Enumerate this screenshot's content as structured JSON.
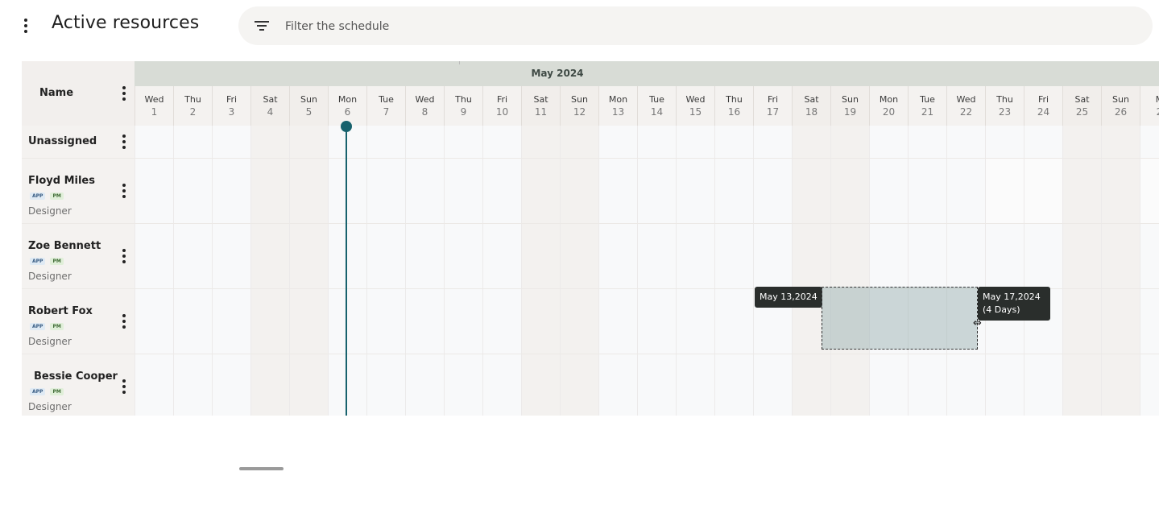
{
  "header": {
    "menu_icon": "kebab-menu-icon",
    "title": "Active resources",
    "search": {
      "icon": "filter-icon",
      "placeholder": "Filter the schedule",
      "value": ""
    }
  },
  "scheduler": {
    "resource_column_label": "Name",
    "month_label": "May 2024",
    "days": [
      {
        "name": "Wed",
        "date": "1",
        "weekend": false
      },
      {
        "name": "Thu",
        "date": "2",
        "weekend": false
      },
      {
        "name": "Fri",
        "date": "3",
        "weekend": false
      },
      {
        "name": "Sat",
        "date": "4",
        "weekend": true
      },
      {
        "name": "Sun",
        "date": "5",
        "weekend": true
      },
      {
        "name": "Mon",
        "date": "6",
        "weekend": false
      },
      {
        "name": "Tue",
        "date": "7",
        "weekend": false
      },
      {
        "name": "Wed",
        "date": "8",
        "weekend": false
      },
      {
        "name": "Thu",
        "date": "9",
        "weekend": false
      },
      {
        "name": "Fri",
        "date": "10",
        "weekend": false
      },
      {
        "name": "Sat",
        "date": "11",
        "weekend": true
      },
      {
        "name": "Sun",
        "date": "12",
        "weekend": true
      },
      {
        "name": "Mon",
        "date": "13",
        "weekend": false
      },
      {
        "name": "Tue",
        "date": "14",
        "weekend": false
      },
      {
        "name": "Wed",
        "date": "15",
        "weekend": false
      },
      {
        "name": "Thu",
        "date": "16",
        "weekend": false
      },
      {
        "name": "Fri",
        "date": "17",
        "weekend": false
      },
      {
        "name": "Sat",
        "date": "18",
        "weekend": true
      },
      {
        "name": "Sun",
        "date": "19",
        "weekend": true
      },
      {
        "name": "Mon",
        "date": "20",
        "weekend": false
      },
      {
        "name": "Tue",
        "date": "21",
        "weekend": false
      },
      {
        "name": "Wed",
        "date": "22",
        "weekend": false
      },
      {
        "name": "Thu",
        "date": "23",
        "weekend": false
      },
      {
        "name": "Fri",
        "date": "24",
        "weekend": false
      },
      {
        "name": "Sat",
        "date": "25",
        "weekend": true
      },
      {
        "name": "Sun",
        "date": "26",
        "weekend": true
      },
      {
        "name": "M",
        "date": "2",
        "weekend": false
      }
    ],
    "today_index": 5,
    "resources": [
      {
        "name": "Unassigned",
        "tags": [],
        "role": ""
      },
      {
        "name": "Floyd Miles",
        "tags": [
          "APP",
          "PM"
        ],
        "role": "Designer"
      },
      {
        "name": "Zoe Bennett",
        "tags": [
          "APP",
          "PM"
        ],
        "role": "Designer"
      },
      {
        "name": "Robert Fox",
        "tags": [
          "APP",
          "PM"
        ],
        "role": "Designer"
      },
      {
        "name": "Bessie Cooper",
        "tags": [
          "APP",
          "PM"
        ],
        "role": "Designer"
      }
    ],
    "selection": {
      "start_label": "May 13,2024",
      "end_label_line1": "May 17,2024",
      "end_label_line2": "(4 Days)",
      "cursor_icon": "resize-horizontal-icon"
    }
  },
  "colors": {
    "today_line": "#17626d",
    "month_band": "#d8dcd6",
    "selection_fill": "#8ca8a8",
    "tooltip_bg": "#2a2e2c"
  }
}
